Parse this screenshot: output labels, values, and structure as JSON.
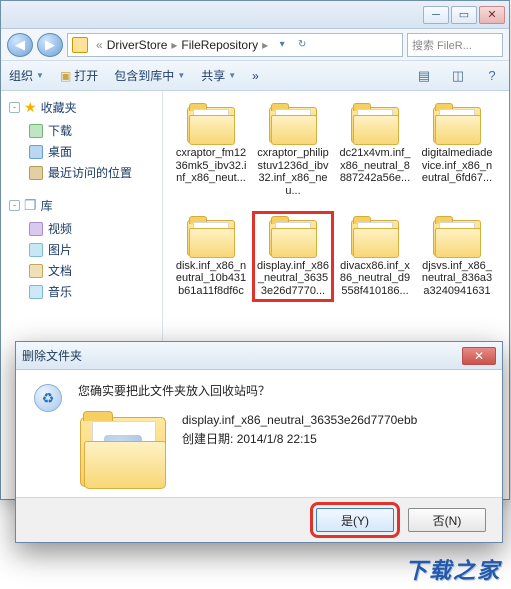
{
  "titlebar": {
    "min_glyph": "─",
    "max_glyph": "▭",
    "close_glyph": "✕"
  },
  "address": {
    "back_glyph": "◀",
    "fwd_glyph": "▶",
    "crumbs": [
      "DriverStore",
      "FileRepository"
    ],
    "sep_glyph": "▸",
    "drop_glyph": "▾",
    "refresh_glyph": "↻",
    "search_placeholder": "搜索 FileR..."
  },
  "toolbar": {
    "organize": "组织",
    "open": "打开",
    "include": "包含到库中",
    "share": "共享",
    "more_glyph": "»",
    "view_glyph": "▤",
    "help_glyph": "?"
  },
  "nav": {
    "favorites": {
      "head": "收藏夹",
      "items": [
        {
          "key": "downloads",
          "label": "下载",
          "cls": "t-dl"
        },
        {
          "key": "desktop",
          "label": "桌面",
          "cls": "t-desk"
        },
        {
          "key": "recent",
          "label": "最近访问的位置",
          "cls": "t-recent"
        }
      ]
    },
    "libraries": {
      "head": "库",
      "items": [
        {
          "key": "videos",
          "label": "视频",
          "cls": "t-vid"
        },
        {
          "key": "pictures",
          "label": "图片",
          "cls": "t-pic"
        },
        {
          "key": "documents",
          "label": "文档",
          "cls": "t-doc"
        },
        {
          "key": "music",
          "label": "音乐",
          "cls": "t-mus"
        }
      ]
    }
  },
  "folders": [
    {
      "name": "cxraptor_fm1236mk5_ibv32.inf_x86_neut..."
    },
    {
      "name": "cxraptor_philipstuv1236d_ibv32.inf_x86_neu..."
    },
    {
      "name": "dc21x4vm.inf_x86_neutral_8887242a56e..."
    },
    {
      "name": "digitalmediadevice.inf_x86_neutral_6fd67..."
    },
    {
      "name": "disk.inf_x86_neutral_10b431b61a11f8df6c"
    },
    {
      "name": "display.inf_x86_neutral_36353e26d7770...",
      "highlight": true
    },
    {
      "name": "divacx86.inf_x86_neutral_d9558f410186..."
    },
    {
      "name": "djsvs.inf_x86_neutral_836a3a3240941631"
    }
  ],
  "dialog": {
    "title": "删除文件夹",
    "close_glyph": "✕",
    "question": "您确实要把此文件夹放入回收站吗？",
    "item_name": "display.inf_x86_neutral_36353e26d7770ebb",
    "created_label": "创建日期:",
    "created_value": "2014/1/8 22:15",
    "yes": "是(Y)",
    "no": "否(N)"
  },
  "watermark": "下载之家"
}
